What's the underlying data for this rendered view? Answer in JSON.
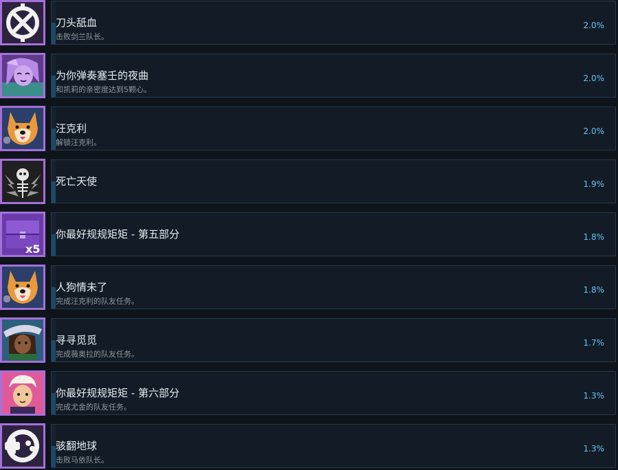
{
  "achievements": [
    {
      "title": "刀头舐血",
      "desc": "击败剑兰队长。",
      "percent": "2.0%",
      "icon": "crossed-swords-icon",
      "fill": 0.5
    },
    {
      "title": "为你弹奏塞壬的夜曲",
      "desc": "和凯莉的亲密度达到5颗心。",
      "percent": "2.0%",
      "icon": "siren-portrait-icon",
      "fill": 0.5
    },
    {
      "title": "汪克利",
      "desc": "解锁汪克利。",
      "percent": "2.0%",
      "icon": "dog-portrait-icon",
      "fill": 0.5
    },
    {
      "title": "死亡天使",
      "desc": "",
      "percent": "1.9%",
      "icon": "skeleton-angel-icon",
      "fill": 0.5
    },
    {
      "title": "你最好规规矩矩 - 第五部分",
      "desc": "",
      "percent": "1.8%",
      "icon": "chest-x5-icon",
      "fill": 0.5
    },
    {
      "title": "人狗情未了",
      "desc": "完成汪克利的队友任务。",
      "percent": "1.8%",
      "icon": "dog-portrait-icon",
      "fill": 0.5
    },
    {
      "title": "寻寻觅觅",
      "desc": "完成薇奥拉的队友任务。",
      "percent": "1.7%",
      "icon": "viola-portrait-icon",
      "fill": 0.5
    },
    {
      "title": "你最好规规矩矩 - 第六部分",
      "desc": "完成尤金的队友任务。",
      "percent": "1.3%",
      "icon": "eugene-portrait-icon",
      "fill": 0.5
    },
    {
      "title": "骇翻地球",
      "desc": "击败马依队长。",
      "percent": "1.3%",
      "icon": "gamepad-emblem-icon",
      "fill": 0.5
    }
  ],
  "colors": {
    "background": "#0f141b",
    "card": "#131c26",
    "card_border": "#26394a",
    "icon_frame": "#a470da",
    "percent": "#66c0f4",
    "title": "#e6ebf0",
    "desc": "#8f98a0",
    "progress_fill": "#1b4a6b"
  }
}
